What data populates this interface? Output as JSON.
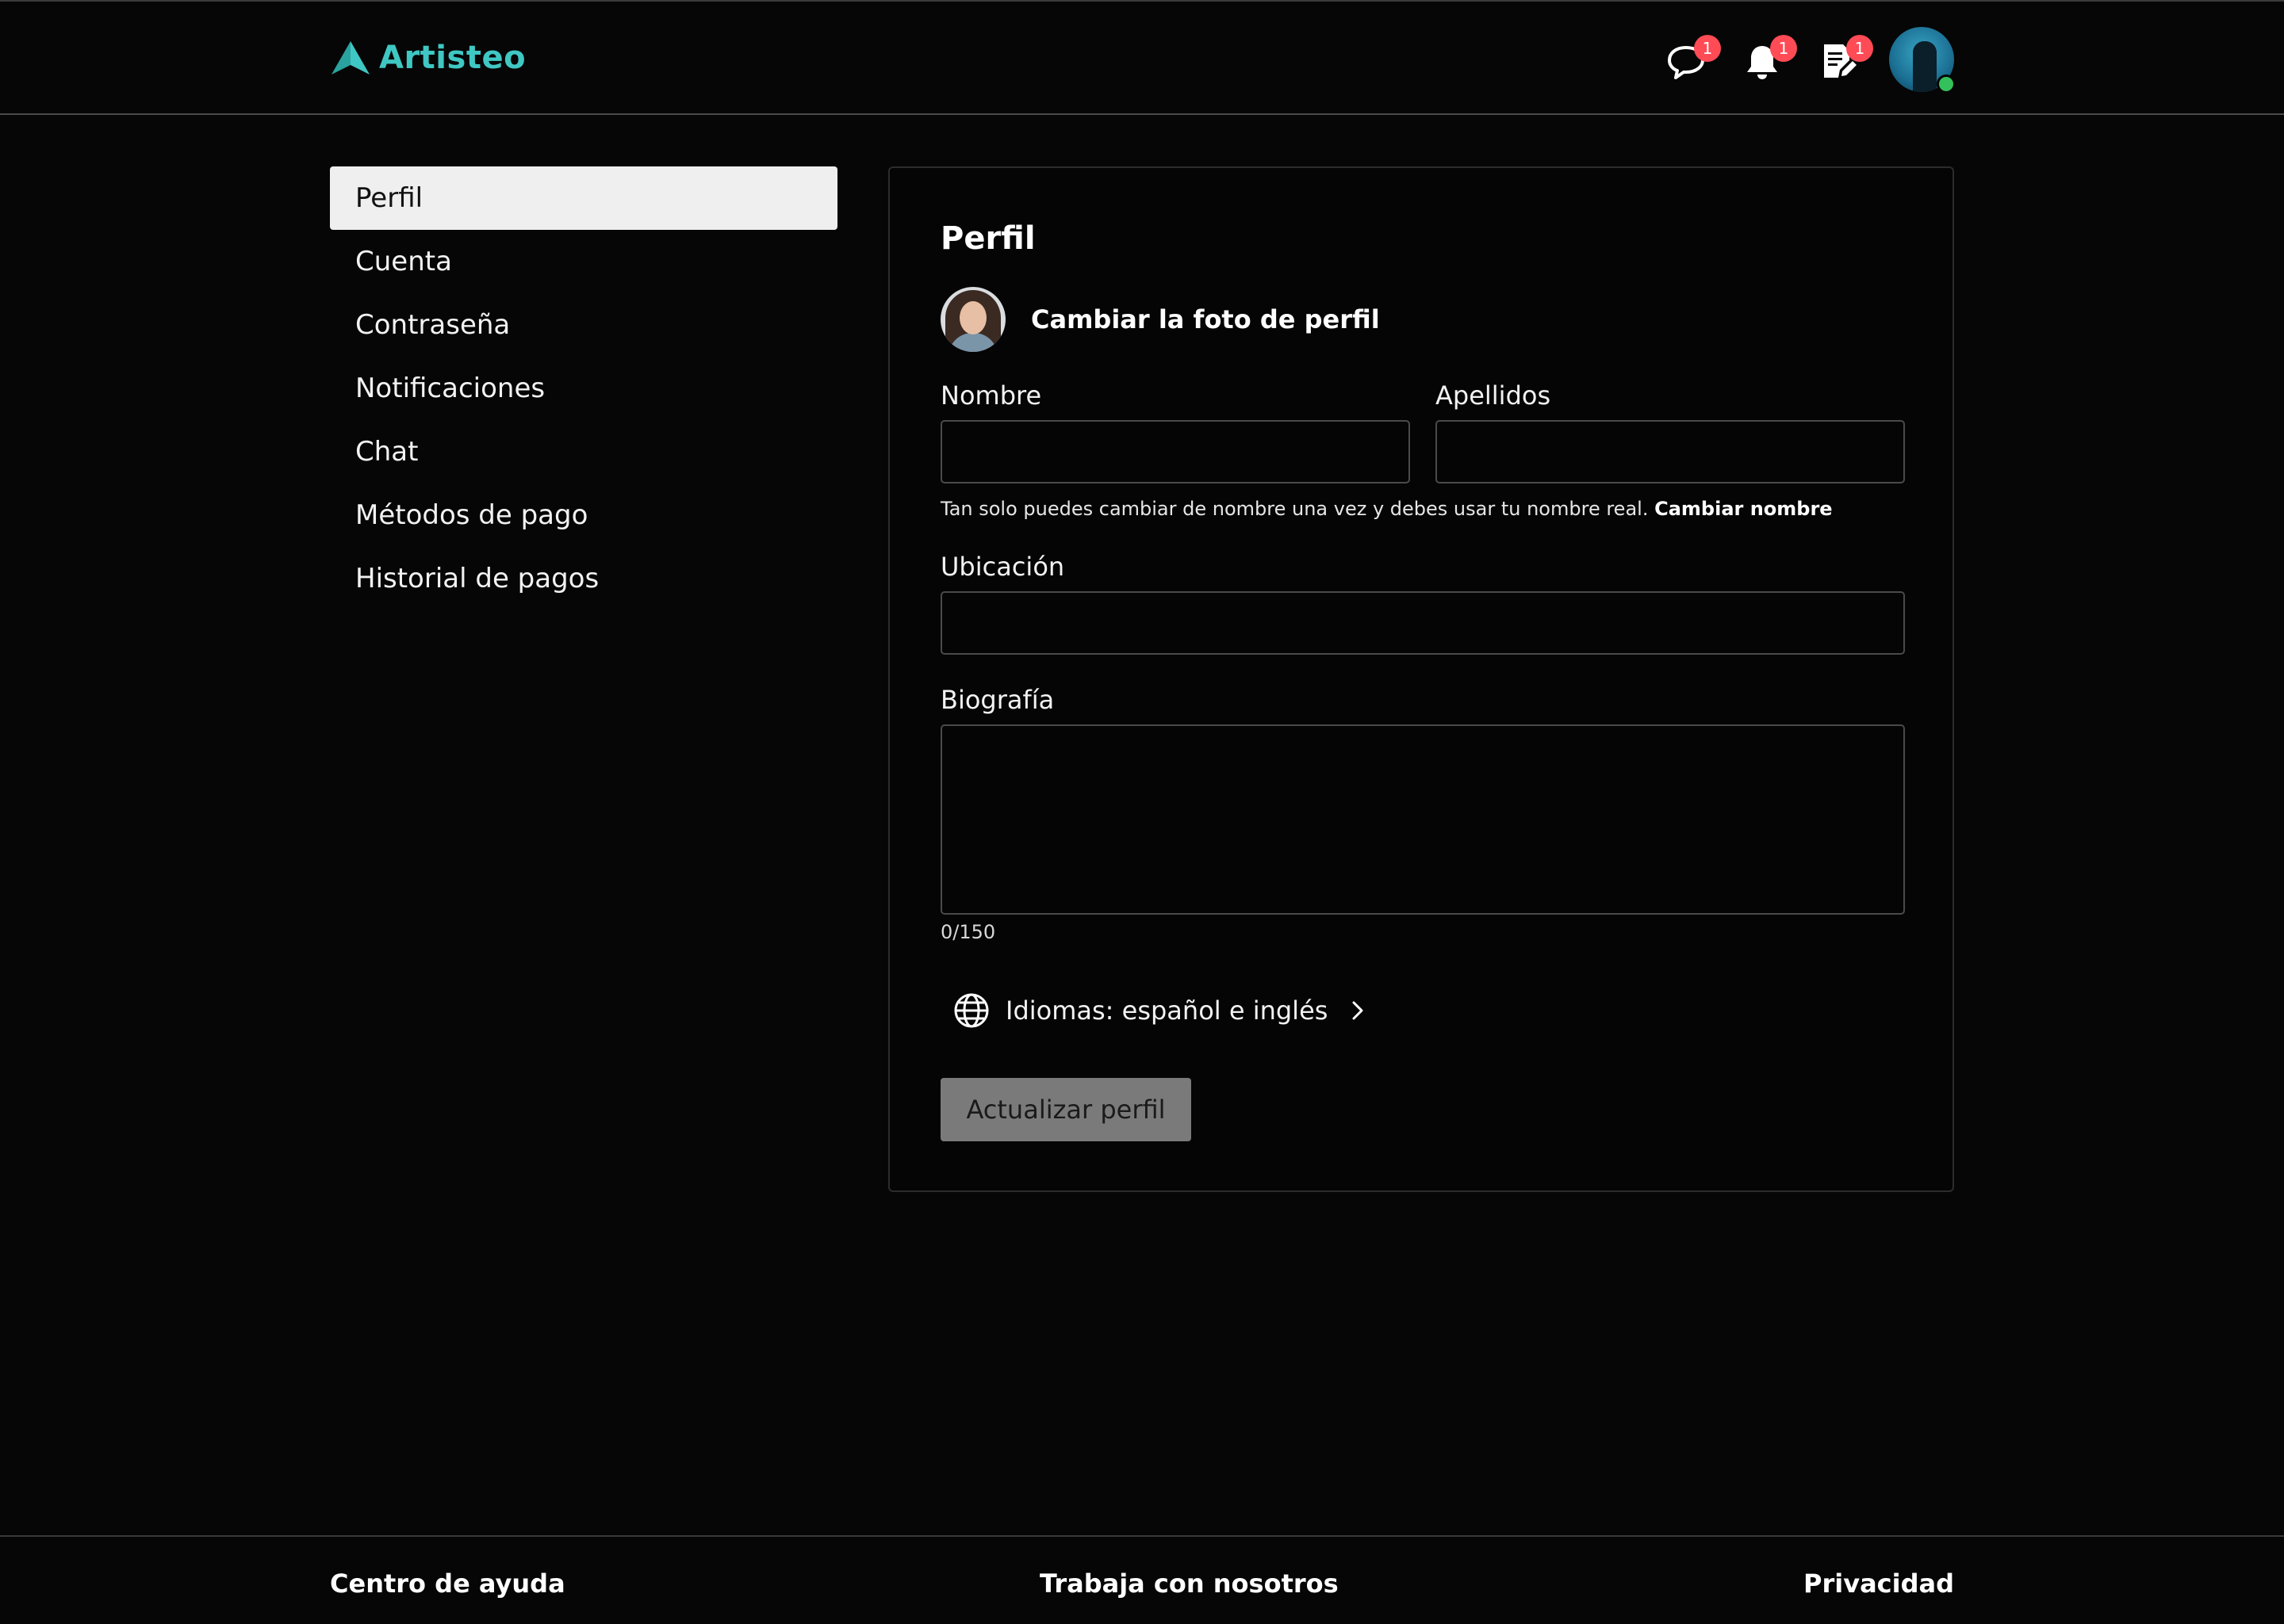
{
  "app": {
    "name": "Artisteo",
    "brand_color": "#3fc7c3"
  },
  "header": {
    "icons": [
      {
        "name": "chat-icon",
        "badge": "1"
      },
      {
        "name": "bell-icon",
        "badge": "1"
      },
      {
        "name": "document-edit-icon",
        "badge": "1"
      }
    ],
    "badge_color": "#ff4b55",
    "online_color": "#34c05a"
  },
  "sidebar": {
    "items": [
      {
        "label": "Perfil",
        "active": true
      },
      {
        "label": "Cuenta",
        "active": false
      },
      {
        "label": "Contraseña",
        "active": false
      },
      {
        "label": "Notificaciones",
        "active": false
      },
      {
        "label": "Chat",
        "active": false
      },
      {
        "label": "Métodos de pago",
        "active": false
      },
      {
        "label": "Historial de pagos",
        "active": false
      }
    ]
  },
  "profile": {
    "title": "Perfil",
    "change_photo_label": "Cambiar la foto de perfil",
    "first_name": {
      "label": "Nombre",
      "value": "",
      "placeholder": ""
    },
    "last_name": {
      "label": "Apellidos",
      "value": "",
      "placeholder": ""
    },
    "name_hint": "Tan solo puedes cambiar de nombre una vez y debes usar tu nombre real.",
    "name_hint_link": "Cambiar nombre",
    "location": {
      "label": "Ubicación",
      "value": "",
      "placeholder": ""
    },
    "bio": {
      "label": "Biografía",
      "value": "",
      "placeholder": "",
      "counter": "0/150"
    },
    "languages_label": "Idiomas: español e inglés",
    "update_button": "Actualizar perfil"
  },
  "footer": {
    "help": "Centro de ayuda",
    "jobs": "Trabaja con nosotros",
    "privacy": "Privacidad"
  }
}
